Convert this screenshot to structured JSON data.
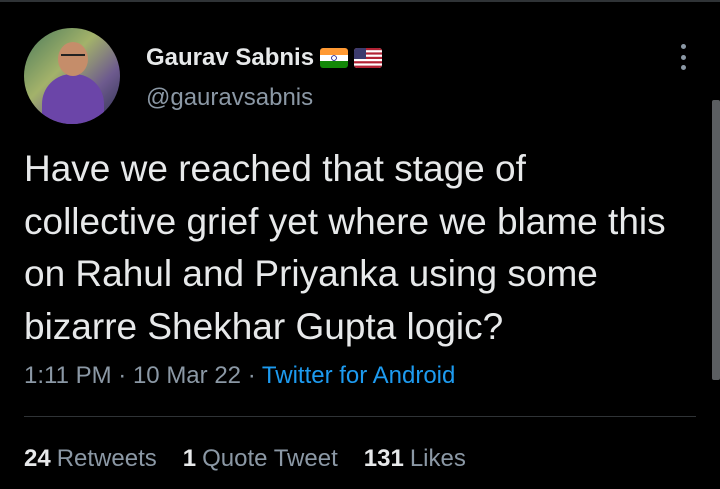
{
  "author": {
    "display_name": "Gaurav Sabnis",
    "handle": "@gauravsabnis",
    "flags": [
      "india-flag-icon",
      "usa-flag-icon"
    ]
  },
  "tweet": {
    "text": "Have we reached that stage of collective grief yet where we blame this on Rahul and Priyanka using some bizarre Shekhar Gupta logic?",
    "time": "1:11 PM",
    "separator": "·",
    "date": "10 Mar 22",
    "source": "Twitter for Android"
  },
  "stats": {
    "retweets_count": "24",
    "retweets_label": "Retweets",
    "quotes_count": "1",
    "quotes_label": "Quote Tweet",
    "likes_count": "131",
    "likes_label": "Likes"
  },
  "colors": {
    "background": "#000000",
    "text": "#e7e9ea",
    "muted": "#8b98a5",
    "link": "#1d9bf0"
  }
}
